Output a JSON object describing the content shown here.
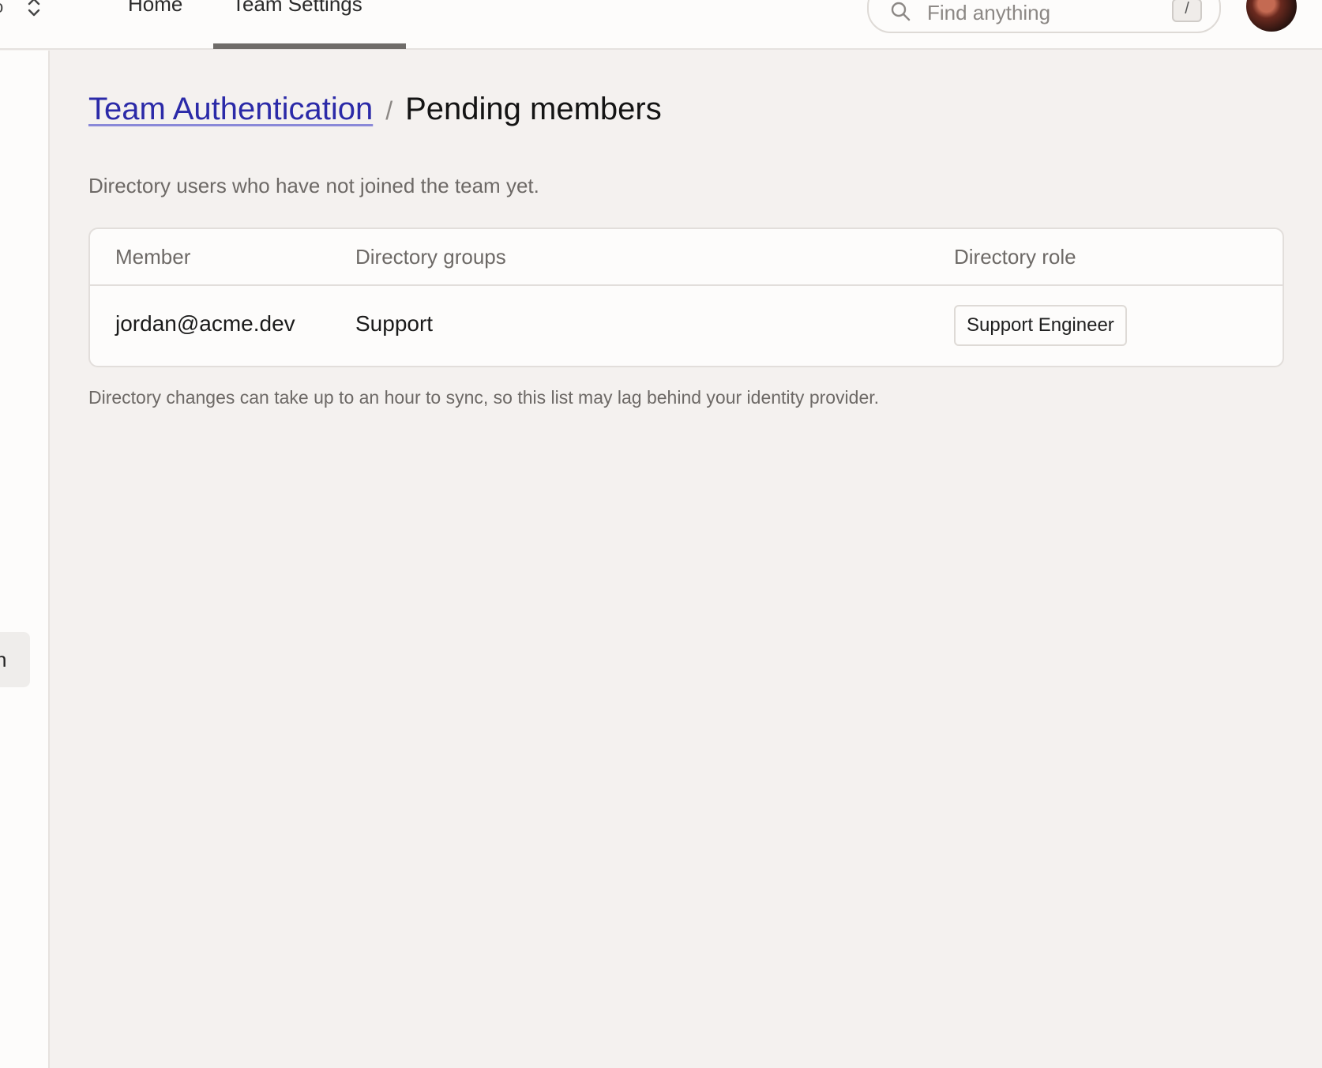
{
  "topbar": {
    "switcher_partial": "o",
    "tabs": [
      {
        "label": "Home",
        "active": false
      },
      {
        "label": "Team Settings",
        "active": true
      }
    ],
    "search": {
      "placeholder": "Find anything",
      "shortcut": "/"
    }
  },
  "sidebar": {
    "active_item_partial": "n"
  },
  "breadcrumb": {
    "parent": "Team Authentication",
    "separator": "/",
    "current": "Pending members"
  },
  "description": "Directory users who have not joined the team yet.",
  "table": {
    "columns": [
      "Member",
      "Directory groups",
      "Directory role"
    ],
    "rows": [
      {
        "member": "jordan@acme.dev",
        "groups": "Support",
        "role": "Support Engineer"
      }
    ]
  },
  "footnote": "Directory changes can take up to an hour to sync, so this list may lag behind your identity provider.",
  "colors": {
    "link": "#2b2aa8",
    "active_tab_underline": "#6f6c69",
    "page_background": "#f4f1ef"
  }
}
